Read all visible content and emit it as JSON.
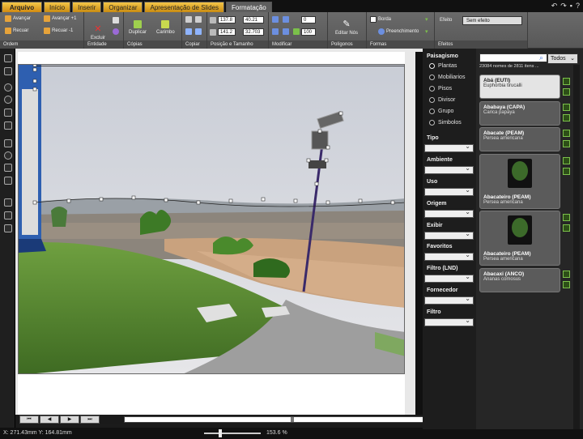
{
  "tabs": [
    "Arquivo",
    "Início",
    "Inserir",
    "Organizar",
    "Apresentação de Slides",
    "Formatação"
  ],
  "ribbon": {
    "ordem": {
      "label": "Ordem",
      "avancar": "Avançar",
      "recuar": "Recuar",
      "avancar1": "Avançar +1",
      "recuar1": "Recuar -1"
    },
    "entidade": {
      "label": "Entidade",
      "excluir": "Excluir"
    },
    "copias": {
      "label": "Cópias",
      "duplicar": "Duplicar",
      "carimbo": "Carimbo"
    },
    "copiar": {
      "label": "Copiar"
    },
    "posicao": {
      "label": "Posição e Tamanho",
      "x": "137.8",
      "w": "40.21",
      "y": "141.2",
      "h": "32.703"
    },
    "modificar": {
      "label": "Modificar",
      "rot": "0",
      "op": "100"
    },
    "poligonos": {
      "label": "Polígonos",
      "editar": "Editar Nós"
    },
    "formas": {
      "label": "Formas",
      "borda": "Borda",
      "preenchimento": "Preenchimento"
    },
    "efeitos": {
      "label": "Efeitos",
      "efeito": "Efeito",
      "sem_efeito": "Sem efeito"
    }
  },
  "filters": {
    "paisagismo": "Paisagismo",
    "options": [
      "Plantas",
      "Mobiliarios",
      "Pisos",
      "Divisor",
      "Grupo",
      "Simbolos"
    ],
    "selected": "Plantas",
    "labels": [
      "Tipo",
      "Ambiente",
      "Uso",
      "Origem",
      "Exibir",
      "Favoritos",
      "Filtro (LND)",
      "Fornecedor",
      "Filtro"
    ]
  },
  "catalog": {
    "search_placeholder": "",
    "scope": "Todos",
    "count": "23084 nomes de 2811 itens ...",
    "items": [
      {
        "name": "Abá (EUTI)",
        "sci": "Euphorbia tirucalli",
        "selected": true
      },
      {
        "name": "Ababaya (CAPA)",
        "sci": "Carica papaya"
      },
      {
        "name": "Abacate (PEAM)",
        "sci": "Persea americana"
      },
      {
        "name": "Abacateiro (PEAM)",
        "sci": "Persea americana"
      },
      {
        "name": "Abacateiro (PEAM)",
        "sci": "Persea americana"
      },
      {
        "name": "Abacaxi (ANCO)",
        "sci": "Ananas comosus"
      }
    ]
  },
  "status": {
    "coords": "X: 271.43mm Y: 164.81mm",
    "zoom": "153.6 %"
  },
  "nav": [
    "⏮",
    "◀",
    "▶",
    "⏭"
  ],
  "colors": {
    "file_tab": "#f2c84a",
    "tree_badge": "#7bc04a",
    "canvas_bg": "#e8e8e8"
  }
}
